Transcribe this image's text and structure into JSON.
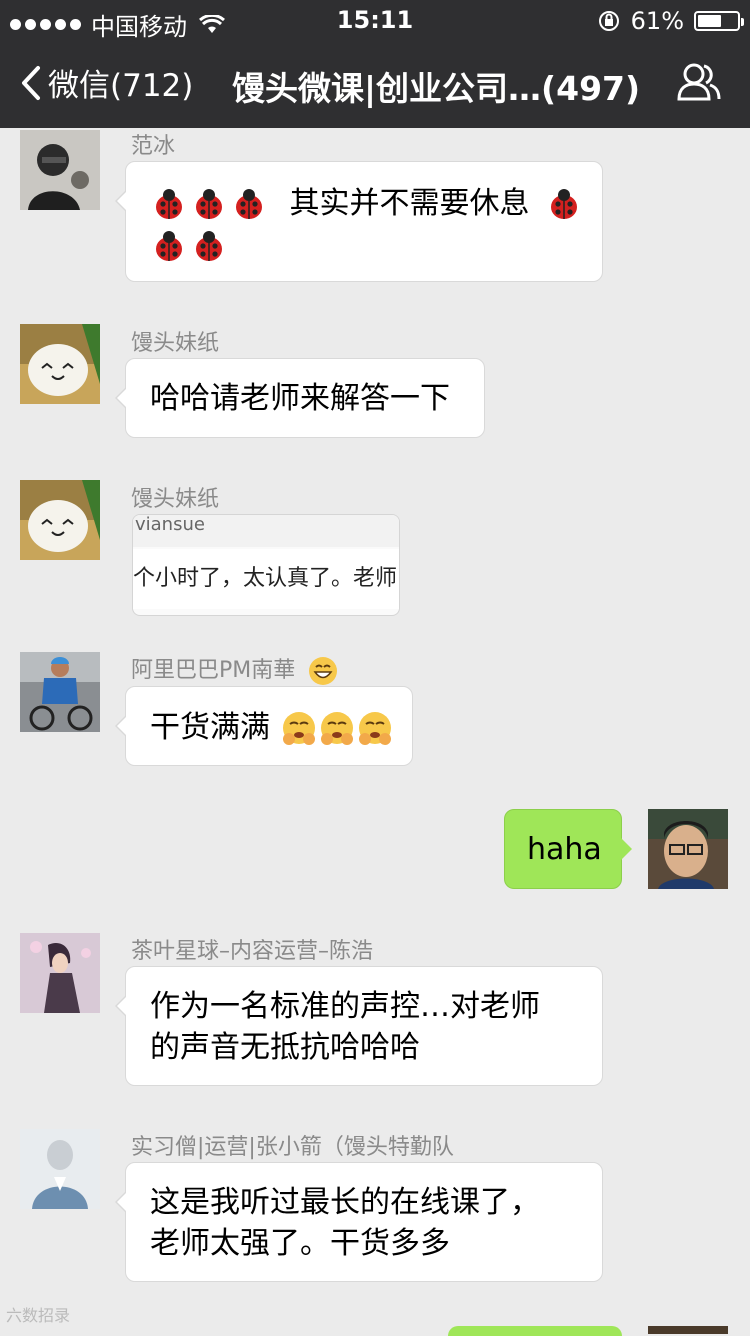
{
  "status_bar": {
    "carrier": "中国移动",
    "time": "15:11",
    "battery_percent_text": "61%",
    "battery_level": 0.61
  },
  "nav": {
    "back_label": "微信(712)",
    "title": "馒头微课|创业公司…(497)"
  },
  "messages": [
    {
      "sender": "范冰",
      "text": "其实并不需要休息"
    },
    {
      "sender": "馒头妹纸",
      "text": "哈哈请老师来解答一下"
    },
    {
      "sender": "馒头妹纸",
      "image_header": "viansue",
      "image_text": "个小时了，太认真了。老师"
    },
    {
      "sender": "阿里巴巴PM南華",
      "text": "干货满满"
    },
    {
      "self": true,
      "text": "haha"
    },
    {
      "sender": "茶叶星球–内容运营–陈浩",
      "line1": "作为一名标准的声控…对老师",
      "line2": "的声音无抵抗哈哈哈"
    },
    {
      "sender": "实习僧|运营|张小箭（馒头特勤队",
      "line1": "这是我听过最长的在线课了，",
      "line2": "老师太强了。干货多多"
    }
  ],
  "watermark": "六数招录",
  "colors": {
    "header_bg": "#2f2f31",
    "chat_bg": "#ebebeb",
    "self_bubble": "#9fe658"
  }
}
